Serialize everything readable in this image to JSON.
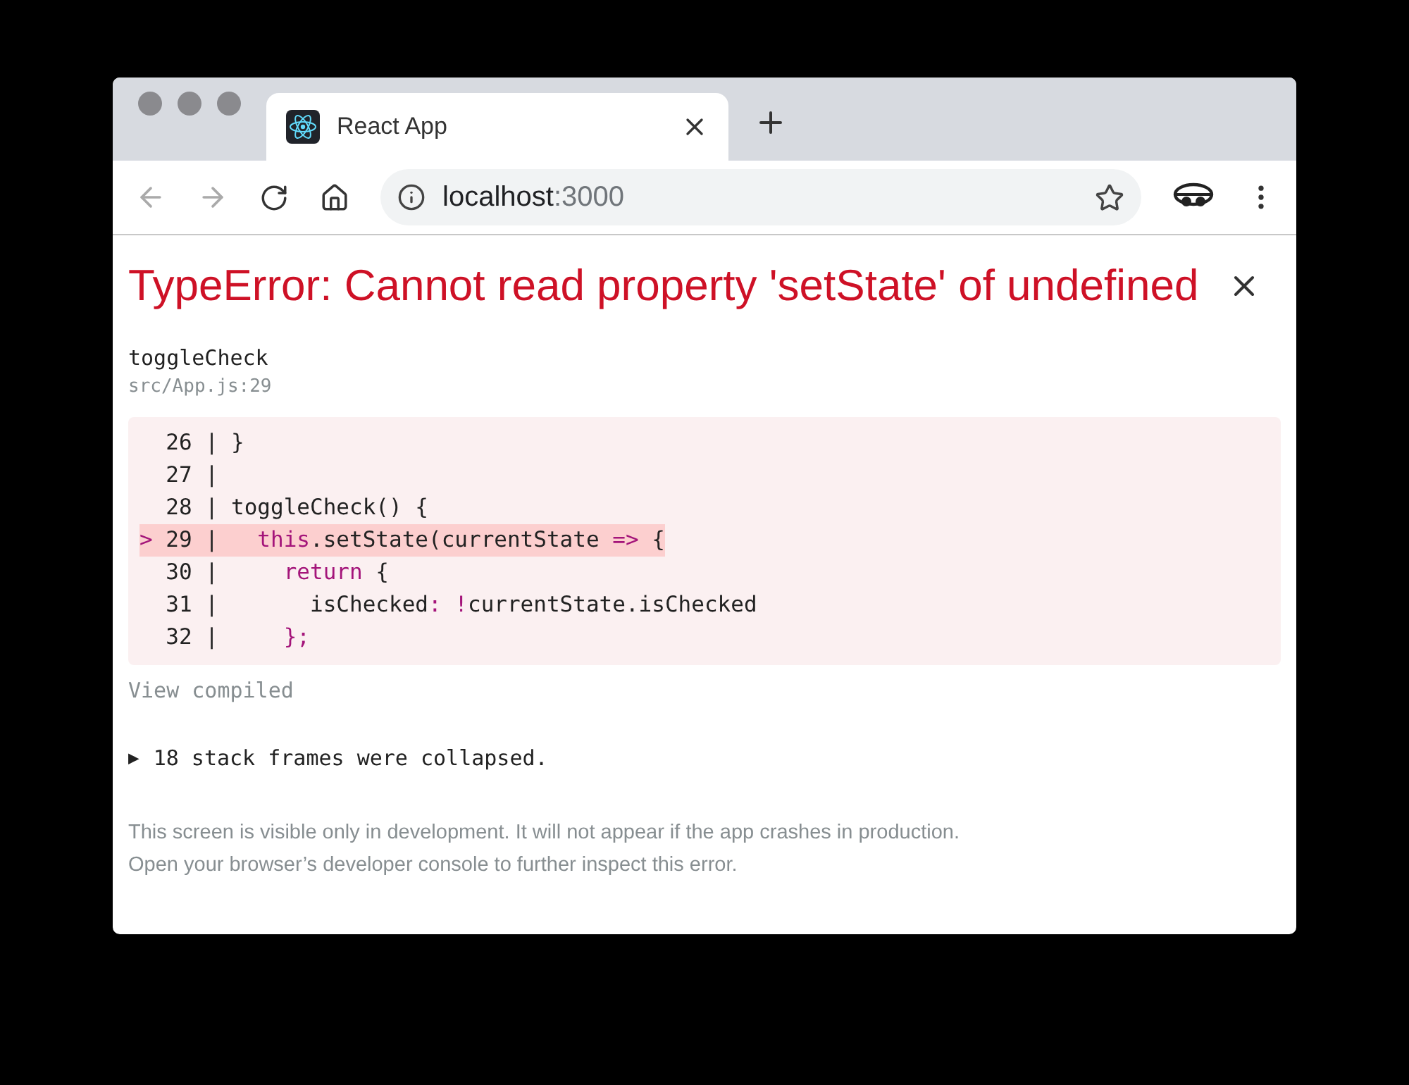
{
  "tabs": [
    {
      "title": "React App",
      "selected": true
    }
  ],
  "address_bar": {
    "host": "localhost",
    "port": ":3000"
  },
  "error": {
    "title": "TypeError: Cannot read property 'setState' of undefined",
    "function": "toggleCheck",
    "location": "src/App.js:29"
  },
  "code": {
    "marker": ">",
    "separator": "|",
    "lines": [
      {
        "number": "26",
        "highlighted": false,
        "tokens": [
          {
            "kind": "plain",
            "text": "}"
          }
        ]
      },
      {
        "number": "27",
        "highlighted": false
      },
      {
        "number": "28",
        "highlighted": false,
        "tokens": [
          {
            "kind": "plain",
            "text": "toggleCheck() {"
          }
        ]
      },
      {
        "number": "29",
        "highlighted": true,
        "tokens": [
          {
            "kind": "keyword",
            "text": "  this"
          },
          {
            "kind": "plain",
            "text": ".setState(currentState "
          },
          {
            "kind": "keyword",
            "text": "=>"
          },
          {
            "kind": "plain",
            "text": " {"
          }
        ]
      },
      {
        "number": "30",
        "highlighted": false,
        "tokens": [
          {
            "kind": "keyword",
            "text": "    return"
          },
          {
            "kind": "plain",
            "text": " {"
          }
        ]
      },
      {
        "number": "31",
        "highlighted": false,
        "tokens": [
          {
            "kind": "plain",
            "text": "      isChecked"
          },
          {
            "kind": "keyword",
            "text": ": !"
          },
          {
            "kind": "plain",
            "text": "currentState.isChecked"
          }
        ]
      },
      {
        "number": "32",
        "highlighted": false,
        "tokens": [
          {
            "kind": "keyword",
            "text": "    };"
          }
        ]
      }
    ]
  },
  "view_compiled": "View compiled",
  "stack": {
    "toggle": "▶",
    "label": "18 stack frames were collapsed."
  },
  "footer": [
    "This screen is visible only in development. It will not appear if the app crashes in production.",
    "Open your browser’s developer console to further inspect this error."
  ]
}
